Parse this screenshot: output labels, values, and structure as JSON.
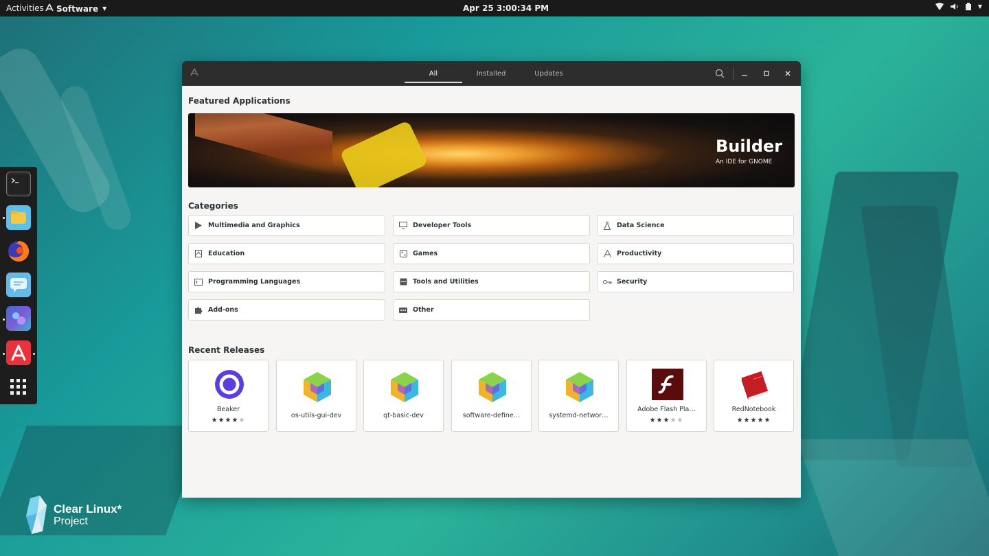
{
  "topbar": {
    "activities": "Activities",
    "app_menu": "Software",
    "clock": "Apr 25   3:00:34 PM"
  },
  "dock": {
    "items": [
      "terminal-icon",
      "files-icon",
      "firefox-icon",
      "chat-icon",
      "photos-icon",
      "software-icon",
      "app-grid-icon"
    ]
  },
  "branding": {
    "line1": "Clear Linux*",
    "line2": "Project"
  },
  "window": {
    "tabs": [
      {
        "label": "All",
        "active": true
      },
      {
        "label": "Installed",
        "active": false
      },
      {
        "label": "Updates",
        "active": false
      }
    ]
  },
  "featured": {
    "section_title": "Featured Applications",
    "title": "Builder",
    "subtitle": "An IDE for GNOME"
  },
  "categories": {
    "section_title": "Categories",
    "items": [
      {
        "label": "Multimedia and Graphics",
        "icon": "play-icon"
      },
      {
        "label": "Developer Tools",
        "icon": "monitor-icon"
      },
      {
        "label": "Data Science",
        "icon": "flask-icon"
      },
      {
        "label": "Education",
        "icon": "book-icon"
      },
      {
        "label": "Games",
        "icon": "dice-icon"
      },
      {
        "label": "Productivity",
        "icon": "pen-icon"
      },
      {
        "label": "Programming Languages",
        "icon": "terminal-icon"
      },
      {
        "label": "Tools and Utilities",
        "icon": "toolbox-icon"
      },
      {
        "label": "Security",
        "icon": "key-icon"
      },
      {
        "label": "Add-ons",
        "icon": "puzzle-icon"
      },
      {
        "label": "Other",
        "icon": "dots-icon"
      }
    ]
  },
  "recent": {
    "section_title": "Recent Releases",
    "apps": [
      {
        "name": "Beaker",
        "rating": 4,
        "icon": "beaker-icon"
      },
      {
        "name": "os-utils-gui-dev",
        "rating": null,
        "icon": "package-icon"
      },
      {
        "name": "qt-basic-dev",
        "rating": null,
        "icon": "package-icon"
      },
      {
        "name": "software-define…",
        "rating": null,
        "icon": "package-icon"
      },
      {
        "name": "systemd-networ…",
        "rating": null,
        "icon": "package-icon"
      },
      {
        "name": "Adobe Flash Pla…",
        "rating": 3,
        "icon": "flash-icon"
      },
      {
        "name": "RedNotebook",
        "rating": 5,
        "icon": "notebook-icon"
      }
    ]
  },
  "colors": {
    "headerbar": "#2d2d2d",
    "topbar": "#1a1a1a",
    "beaker": "#5b3de0",
    "flash": "#5a0c0c"
  }
}
